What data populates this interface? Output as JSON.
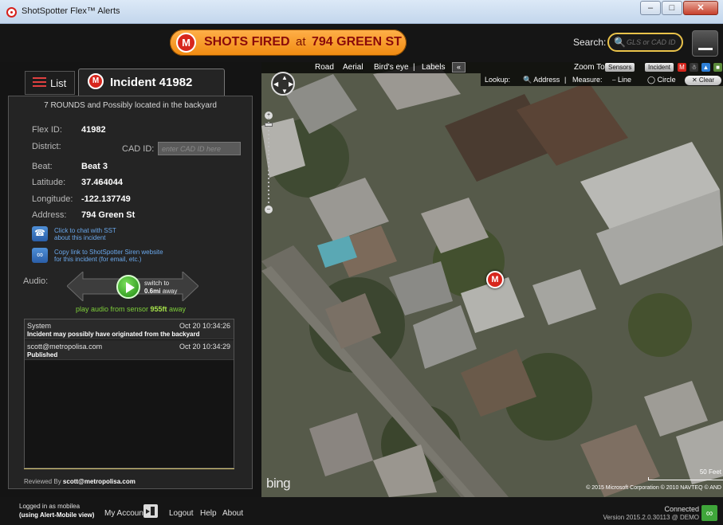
{
  "window": {
    "title": "ShotSpotter Flex™ Alerts"
  },
  "header": {
    "alert_badge": "M",
    "alert_type": "SHOTS FIRED",
    "alert_at": "at",
    "alert_address": "794 GREEN ST",
    "search_label": "Search:",
    "search_placeholder": "GLS or CAD ID"
  },
  "tabs": {
    "list_label": "List",
    "incident_label": "Incident 41982",
    "incident_badge": "M"
  },
  "incident": {
    "summary": "7 ROUNDS and Possibly located in the backyard",
    "flex_id_label": "Flex ID:",
    "flex_id": "41982",
    "district_label": "District:",
    "district": "",
    "cad_label": "CAD ID:",
    "cad_placeholder": "enter CAD ID here",
    "beat_label": "Beat:",
    "beat": "Beat 3",
    "latitude_label": "Latitude:",
    "latitude": "37.464044",
    "longitude_label": "Longitude:",
    "longitude": "-122.137749",
    "address_label": "Address:",
    "address": "794 Green St",
    "chat_link_line1": "Click to chat with SST",
    "chat_link_line2": "about this incident",
    "copy_link_line1": "Copy link to ShotSpotter Siren website",
    "copy_link_line2": "for this incident (for email, etc.)",
    "audio_label": "Audio:",
    "switch_line1": "switch to",
    "switch_distance": "0.6mi",
    "switch_suffix": "away",
    "play_prefix": "play audio from sensor",
    "play_distance": "955ft",
    "play_suffix": "away",
    "reviewed_prefix": "Reviewed By",
    "reviewed_by": "scott@metropolisa.com"
  },
  "log": [
    {
      "author": "System",
      "time": "Oct 20 10:34:26",
      "message": "Incident may possibly have originated from the backyard"
    },
    {
      "author": "scott@metropolisa.com",
      "time": "Oct 20 10:34:29",
      "message": "Published"
    }
  ],
  "map": {
    "toolbar": [
      "Road",
      "Aerial",
      "Bird's eye",
      "|",
      "Labels"
    ],
    "collapse": "«",
    "zoom_to_label": "Zoom To",
    "zoom_sensors": "Sensors",
    "zoom_incident": "Incident",
    "lookup_label": "Lookup:",
    "lookup_address": "Address",
    "measure_label": "Measure:",
    "measure_line": "Line",
    "measure_circle": "Circle",
    "clear_label": "Clear",
    "marker": "M",
    "bing": "bing",
    "scale": "50 Feet",
    "copyright": "© 2015 Microsoft Corporation   © 2010 NAVTEQ   © AND"
  },
  "status": {
    "logged_in_prefix": "Logged in as",
    "user": "mobilea",
    "view_prefix": "(using",
    "view_name": "Alert-Mobile",
    "view_suffix": "view)",
    "my_account": "My Account",
    "logout": "Logout",
    "help": "Help",
    "about": "About",
    "connected": "Connected",
    "version": "Version 2015.2.0.30113 @ DEMO"
  }
}
